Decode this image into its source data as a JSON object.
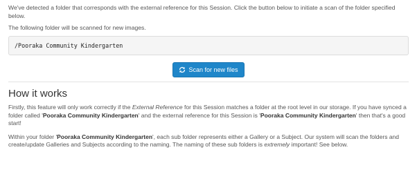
{
  "intro": "We've detected a folder that corresponds with the external reference for this Session. Click the button below to initiate a scan of the folder specified below.",
  "subintro": "The following folder will be scanned for new images.",
  "folder_path": "/Pooraka Community Kindergarten",
  "button": {
    "label": "Scan for new files",
    "icon": "refresh-icon",
    "color": "#1f86c9"
  },
  "section_title": "How it works",
  "para1": {
    "a": "Firstly, this feature will only work correctly if the ",
    "em": "External Reference",
    "b": " for this Session matches a folder at the root level in our storage. If you have synced a folder called '",
    "bold1": "Pooraka Community Kindergarten",
    "c": "' and the external reference for this Session is '",
    "bold2": "Pooraka Community Kindergarten",
    "d": "' then that's a good start!"
  },
  "para2": {
    "a": "Within your folder '",
    "bold": "Pooraka Community Kindergarten",
    "b": "', each sub folder represents either a Gallery or a Subject. Our system will scan the folders and create/update Galleries and Subjects according to the naming. The naming of these sub folders is ",
    "em": "extremely",
    "c": " important! See below."
  }
}
